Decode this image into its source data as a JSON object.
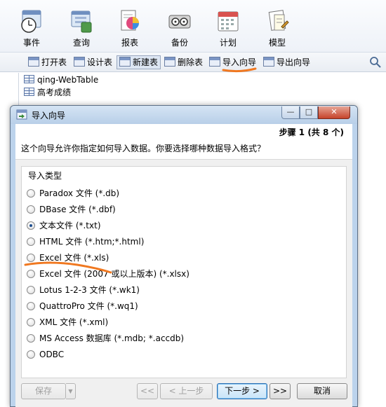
{
  "ribbon": {
    "items": [
      {
        "label": "事件",
        "icon": "event-clock-icon"
      },
      {
        "label": "查询",
        "icon": "query-icon"
      },
      {
        "label": "报表",
        "icon": "report-chart-icon"
      },
      {
        "label": "备份",
        "icon": "backup-icon"
      },
      {
        "label": "计划",
        "icon": "schedule-calendar-icon"
      },
      {
        "label": "模型",
        "icon": "model-icon"
      }
    ]
  },
  "toolbar": {
    "open_table": "打开表",
    "design_table": "设计表",
    "new_table": "新建表",
    "delete_table": "删除表",
    "import_wizard": "导入向导",
    "export_wizard": "导出向导"
  },
  "tables": [
    "qing-WebTable",
    "高考成绩"
  ],
  "dialog": {
    "title": "导入向导",
    "step": "步骤 1 (共 8 个)",
    "intro": "这个向导允许你指定如何导入数据。你要选择哪种数据导入格式？",
    "group_label": "导入类型",
    "options": [
      {
        "label": "Paradox 文件 (*.db)",
        "checked": false
      },
      {
        "label": "DBase 文件 (*.dbf)",
        "checked": false
      },
      {
        "label": "文本文件 (*.txt)",
        "checked": true
      },
      {
        "label": "HTML 文件 (*.htm;*.html)",
        "checked": false
      },
      {
        "label": "Excel 文件 (*.xls)",
        "checked": false
      },
      {
        "label": "Excel 文件 (2007 或以上版本) (*.xlsx)",
        "checked": false
      },
      {
        "label": "Lotus 1-2-3 文件 (*.wk1)",
        "checked": false
      },
      {
        "label": "QuattroPro 文件 (*.wq1)",
        "checked": false
      },
      {
        "label": "XML 文件 (*.xml)",
        "checked": false
      },
      {
        "label": "MS Access 数据库 (*.mdb; *.accdb)",
        "checked": false
      },
      {
        "label": "ODBC",
        "checked": false
      }
    ],
    "buttons": {
      "save": "保存",
      "first": "<<",
      "prev": "< 上一步",
      "next": "下一步 >",
      "last": ">>",
      "cancel": "取消"
    }
  },
  "colors": {
    "annotation": "#f07820",
    "close_button": "#c6432a",
    "radio_checked": "#1f4f8f"
  }
}
